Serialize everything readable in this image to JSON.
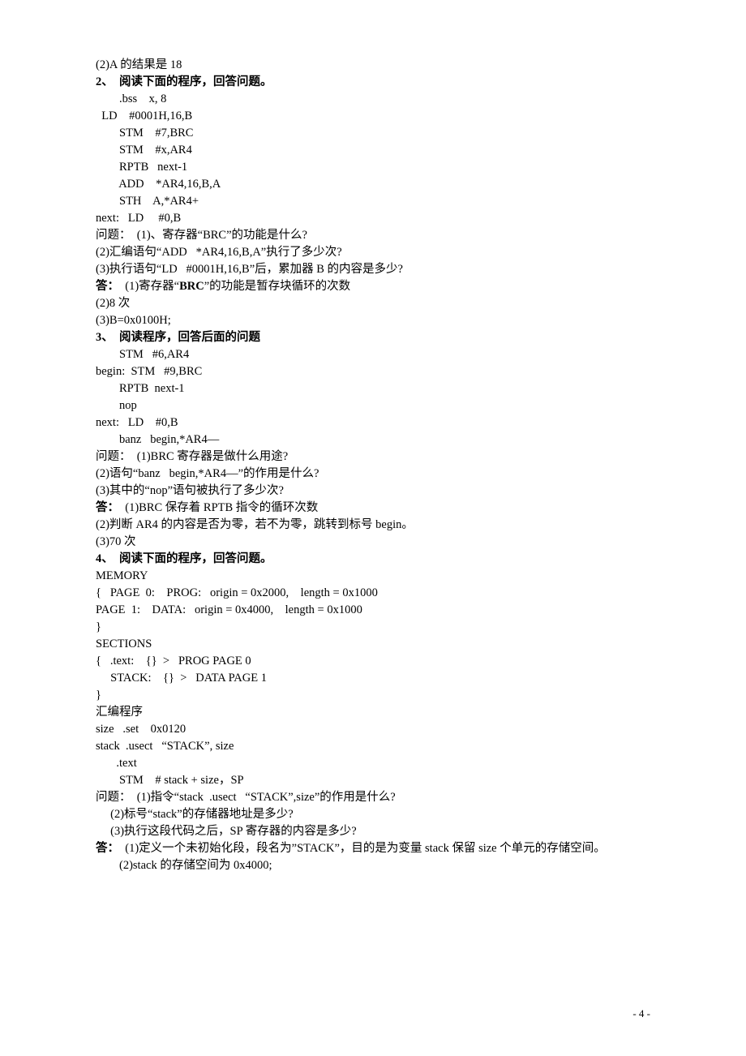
{
  "lines": [
    {
      "style": "",
      "text": "(2)A 的结果是 18"
    },
    {
      "style": "bold",
      "text": "2、  阅读下面的程序，回答问题。"
    },
    {
      "style": "",
      "text": "        .bss    x, 8"
    },
    {
      "style": "",
      "text": "  LD    #0001H,16,B"
    },
    {
      "style": "",
      "text": "        STM    #7,BRC"
    },
    {
      "style": "",
      "text": "        STM    #x,AR4"
    },
    {
      "style": "",
      "text": "        RPTB   next-1"
    },
    {
      "style": "",
      "text": "        ADD    *AR4,16,B,A"
    },
    {
      "style": "",
      "text": "        STH    A,*AR4+"
    },
    {
      "style": "",
      "text": "next:   LD     #0,B"
    },
    {
      "style": "",
      "text": "问题：  (1)、寄存器“BRC”的功能是什么?"
    },
    {
      "style": "",
      "text": "(2)汇编语句“ADD   *AR4,16,B,A”执行了多少次?"
    },
    {
      "style": "",
      "text": "(3)执行语句“LD   #0001H,16,B”后，累加器 B 的内容是多少?"
    },
    {
      "style": "",
      "text": "答：  (1)寄存器“BRC”的功能是暂存块循环的次数",
      "boldPrefix": "答：",
      "boldMid": "BRC"
    },
    {
      "style": "",
      "text": "(2)8 次"
    },
    {
      "style": "",
      "text": "(3)B=0x0100H;"
    },
    {
      "style": "bold",
      "text": "3、  阅读程序，回答后面的问题"
    },
    {
      "style": "",
      "text": "        STM   #6,AR4"
    },
    {
      "style": "",
      "text": "begin:  STM   #9,BRC"
    },
    {
      "style": "",
      "text": "        RPTB  next-1"
    },
    {
      "style": "",
      "text": "        nop"
    },
    {
      "style": "",
      "text": "next:   LD    #0,B"
    },
    {
      "style": "",
      "text": "        banz   begin,*AR4—"
    },
    {
      "style": "",
      "text": "问题：  (1)BRC 寄存器是做什么用途?"
    },
    {
      "style": "",
      "text": "(2)语句“banz   begin,*AR4—”的作用是什么?"
    },
    {
      "style": "",
      "text": "(3)其中的“nop”语句被执行了多少次?"
    },
    {
      "style": "",
      "text": "答：  (1)BRC 保存着 RPTB 指令的循环次数",
      "boldPrefix": "答："
    },
    {
      "style": "",
      "text": "(2)判断 AR4 的内容是否为零，若不为零，跳转到标号 begin。"
    },
    {
      "style": "",
      "text": "(3)70 次"
    },
    {
      "style": "bold",
      "text": "4、  阅读下面的程序，回答问题。"
    },
    {
      "style": "",
      "text": "MEMORY"
    },
    {
      "style": "",
      "text": "{   PAGE  0:    PROG:   origin = 0x2000,    length = 0x1000"
    },
    {
      "style": "",
      "text": "PAGE  1:    DATA:   origin = 0x4000,    length = 0x1000"
    },
    {
      "style": "",
      "text": "}"
    },
    {
      "style": "",
      "text": "SECTIONS"
    },
    {
      "style": "",
      "text": "{   .text:    {}  >   PROG PAGE 0"
    },
    {
      "style": "",
      "text": "     STACK:    {}  >   DATA PAGE 1"
    },
    {
      "style": "",
      "text": "}"
    },
    {
      "style": "",
      "text": "汇编程序"
    },
    {
      "style": "",
      "text": "size   .set    0x0120"
    },
    {
      "style": "",
      "text": "stack  .usect   “STACK”, size"
    },
    {
      "style": "",
      "text": "       .text"
    },
    {
      "style": "",
      "text": "        STM    # stack + size，SP"
    },
    {
      "style": "",
      "text": "问题：  (1)指令“stack  .usect   “STACK”,size”的作用是什么?"
    },
    {
      "style": "",
      "text": "     (2)标号“stack”的存储器地址是多少?"
    },
    {
      "style": "",
      "text": "     (3)执行这段代码之后，SP 寄存器的内容是多少?"
    },
    {
      "style": "",
      "text": "答：  (1)定义一个未初始化段，段名为”STACK”，目的是为变量 stack 保留 size 个单元的存储空间。",
      "boldPrefix": "答："
    },
    {
      "style": "",
      "text": "        (2)stack 的存储空间为 0x4000;"
    }
  ],
  "pageNum": "- 4 -"
}
